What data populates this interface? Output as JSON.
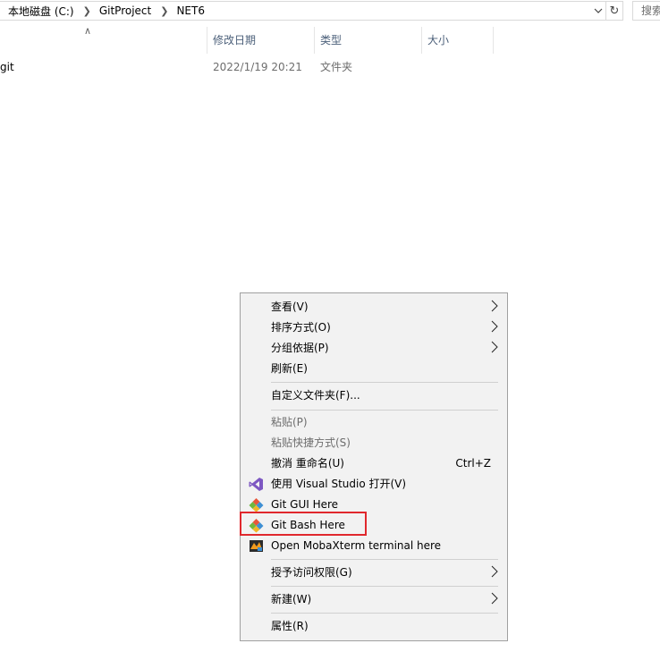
{
  "address": {
    "crumbs": [
      "本地磁盘 (C:)",
      "GitProject",
      "NET6"
    ],
    "search_placeholder": "搜索"
  },
  "columns": [
    {
      "label": ""
    },
    {
      "label": "修改日期"
    },
    {
      "label": "类型"
    },
    {
      "label": "大小"
    }
  ],
  "files": [
    {
      "name": "git",
      "modified": "2022/1/19 20:21",
      "type": "文件夹",
      "size": ""
    }
  ],
  "context_menu": {
    "items": [
      {
        "label": "查看(V)"
      },
      {
        "label": "排序方式(O)"
      },
      {
        "label": "分组依据(P)"
      },
      {
        "label": "刷新(E)"
      },
      {
        "label": "自定义文件夹(F)..."
      },
      {
        "label": "粘贴(P)"
      },
      {
        "label": "粘贴快捷方式(S)"
      },
      {
        "label": "撤消 重命名(U)",
        "shortcut": "Ctrl+Z"
      },
      {
        "label": "使用 Visual Studio 打开(V)"
      },
      {
        "label": "Git GUI Here"
      },
      {
        "label": "Git Bash Here"
      },
      {
        "label": "Open MobaXterm terminal here"
      },
      {
        "label": "授予访问权限(G)"
      },
      {
        "label": "新建(W)"
      },
      {
        "label": "属性(R)"
      }
    ]
  },
  "colors": {
    "menu_bg": "#f2f2f2",
    "highlight_border": "#e0282d",
    "header_text": "#4c607a"
  }
}
